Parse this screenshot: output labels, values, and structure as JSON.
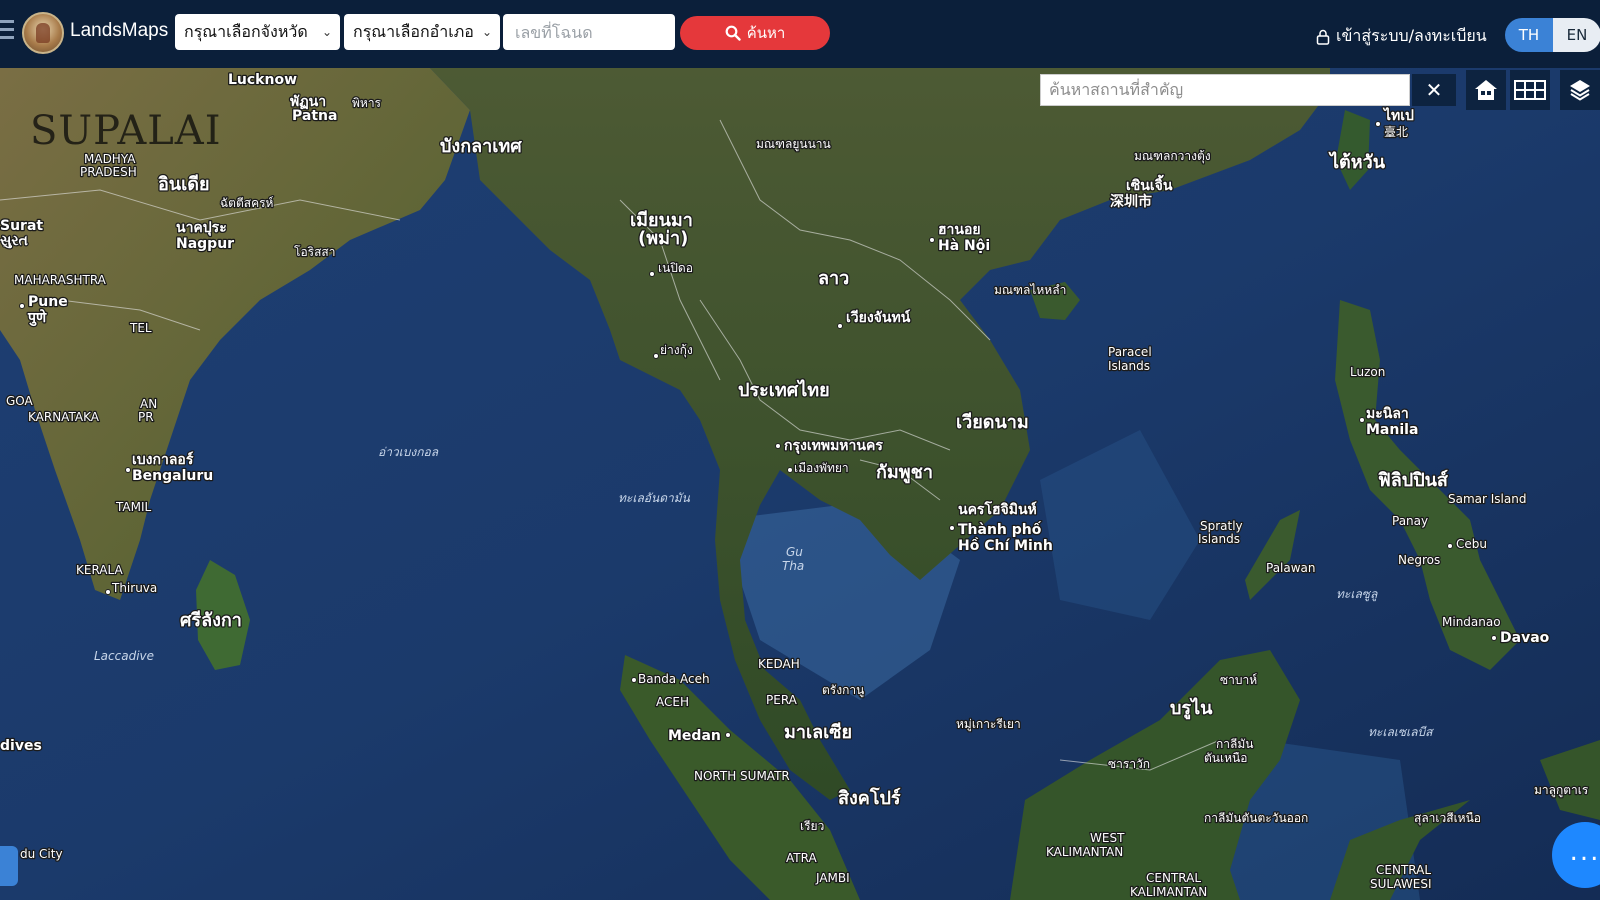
{
  "app": {
    "brand": "LandsMaps",
    "province_select": "กรุณาเลือกจังหวัด",
    "district_select": "กรุณาเลือกอำเภอ",
    "deed_placeholder": "เลขที่โฉนด",
    "search_label": "ค้นหา",
    "login_label": "เข้าสู่ระบบ/ลงทะเบียน",
    "lang_th": "TH",
    "lang_en": "EN",
    "watermark": "SUPALAI"
  },
  "map": {
    "place_search_placeholder": "ค้นหาสถานที่สำคัญ",
    "clear_icon": "close-icon",
    "controls": [
      "home-icon",
      "grid-icon",
      "layers-icon"
    ],
    "fab_label": "...",
    "labels": {
      "india": "อินเดีย",
      "madhya": "MADHYA",
      "pradesh": "PRADESH",
      "lucknow": "Lucknow",
      "patna": "Patna",
      "patna_th": "พัฏนา",
      "bihar": "พิหาร",
      "bangladesh": "บังกลาเทศ",
      "nagpur": "Nagpur",
      "nagpur_th": "นาคปุระ",
      "chhattisgarh": "ฉัตตีสครห์",
      "odisha": "โอริสสา",
      "maharashtra": "MAHARASHTRA",
      "pune": "Pune",
      "pune_local": "पुणे",
      "surat": "Surat",
      "surat_local": "સુરત",
      "telangana": "TEL",
      "goa": "GOA",
      "karnataka": "KARNATAKA",
      "andhra": "AN",
      "andhra2": "PR",
      "bengaluru_th": "เบงกาลอร์",
      "bengaluru": "Bengaluru",
      "tamil": "TAMIL",
      "kerala": "KERALA",
      "thiruvananthapuram": "Thiruva",
      "srilanka": "ศรีลังกา",
      "laccadive": "Laccadive",
      "maldives": "dives",
      "bay_of_bengal": "อ่าวเบงกอล",
      "myanmar": "เมียนมา",
      "myanmar2": "(พม่า)",
      "naypyidaw": "เนปิดอ",
      "yangon": "ย่างกุ้ง",
      "thailand": "ประเทศไทย",
      "bangkok": "กรุงเทพมหานคร",
      "pattaya": "เมืองพัทยา",
      "laos": "ลาว",
      "vientiane": "เวียงจันทน์",
      "vietnam": "เวียดนาม",
      "hanoi_th": "ฮานอย",
      "hanoi": "Hà Nội",
      "cambodia": "กัมพูชา",
      "hcmc_th": "นครโฮจิมินห์",
      "hcmc1": "Thành phố",
      "hcmc2": "Hồ Chí Minh",
      "yunnan": "มณฑลยูนนาน",
      "guangdong": "มณฑลกวางตุ้ง",
      "shenzhen_th": "เซินเจิ้น",
      "shenzhen": "深圳市",
      "hainan": "มณฑลไหหลำ",
      "taiwan": "ไต้หวัน",
      "taipei": "ไทเป",
      "taipei_local": "臺北",
      "paracel": "Paracel",
      "paracel2": "Islands",
      "spratly": "Spratly",
      "spratly2": "Islands",
      "luzon": "Luzon",
      "manila_th": "มะนิลา",
      "manila": "Manila",
      "philippines": "ฟิลิปปินส์",
      "samar": "Samar Island",
      "panay": "Panay",
      "cebu": "Cebu",
      "negros": "Negros",
      "palawan": "Palawan",
      "mindanao": "Mindanao",
      "davao": "Davao",
      "gulf_thai": "Gu",
      "gulf_thai2": "Tha",
      "andaman": "ทะเลอันดามัน",
      "kedah": "KEDAH",
      "perak": "PERA",
      "terengganu": "ตรังกานู",
      "malaysia": "มาเลเซีย",
      "banda_aceh": "Banda Aceh",
      "aceh": "ACEH",
      "medan": "Medan",
      "north_sumatra": "NORTH SUMATR",
      "singapore": "สิงคโปร์",
      "riau": "เรียว",
      "jambi": "JAMBI",
      "atra": "ATRA",
      "natuna": "หมู่เกาะรีเยา",
      "brunei": "บรูไน",
      "sabah": "ซาบาห์",
      "sarawak": "ซาราวัก",
      "kalimantan_w": "WEST",
      "kalimantan_w2": "KALIMANTAN",
      "kalimantan_c": "CENTRAL",
      "kalimantan_c2": "KALIMANTAN",
      "kalimantan_e": "กาลีมันตันตะวันออก",
      "kalimantan_n": "กาลีมัน",
      "kalimantan_n2": "ตันเหนือ",
      "sulawesi": "CENTRAL",
      "sulawesi2": "SULAWESI",
      "sulawesi_n": "สุลาเวสีเหนือ",
      "celebes_sea": "ทะเลเซเลบีส",
      "sulu_sea": "ทะเลซูลู",
      "maluku": "มาลูกูตาเร",
      "du_city": "du City"
    }
  }
}
